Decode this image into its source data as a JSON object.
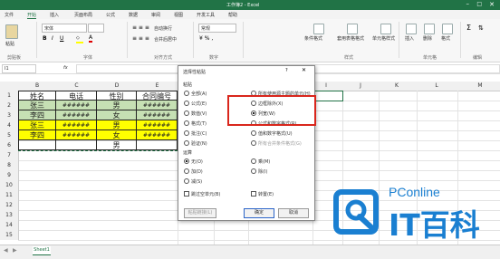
{
  "window": {
    "title": "工作簿2 - Excel"
  },
  "menu": {
    "tabs": [
      "文件",
      "开始",
      "插入",
      "页面布局",
      "公式",
      "数据",
      "审阅",
      "视图",
      "开发工具",
      "帮助"
    ],
    "active": "开始"
  },
  "ribbon": {
    "clipboard": {
      "paste": "粘贴",
      "group": "剪贴板"
    },
    "font": {
      "font_name": "宋体",
      "group": "字体"
    },
    "alignment": {
      "wrap": "自动换行",
      "merge": "合并后居中",
      "group": "对齐方式"
    },
    "number": {
      "format": "常规",
      "group": "数字"
    },
    "styles": {
      "conditional": "条件格式",
      "table": "套用表格格式",
      "cell": "单元格样式",
      "group": "样式"
    },
    "cells": {
      "insert": "插入",
      "delete": "删除",
      "format": "格式",
      "group": "单元格"
    },
    "editing": {
      "group": "编辑"
    }
  },
  "formula_bar": {
    "name_box": "I1",
    "fx": "fx"
  },
  "sheet": {
    "columns": [
      "B",
      "C",
      "D",
      "E",
      "F",
      "G",
      "H",
      "I",
      "J",
      "K",
      "L",
      "M"
    ],
    "row_numbers": [
      "1",
      "2",
      "3",
      "4",
      "5",
      "6",
      "7",
      "8",
      "9",
      "10",
      "11",
      "12",
      "13",
      "14",
      "15"
    ],
    "headers": [
      "姓名",
      "电话",
      "性别",
      "合同编号"
    ],
    "rows": [
      [
        "张三",
        "######",
        "男",
        "######"
      ],
      [
        "李四",
        "######",
        "女",
        "######"
      ],
      [
        "张三",
        "######",
        "男",
        "######"
      ],
      [
        "李四",
        "######",
        "女",
        "######"
      ],
      [
        "",
        "",
        "男",
        ""
      ]
    ],
    "colors": {
      "green_rows": "#c6e0b4",
      "yellow_rows": "#ffff00"
    },
    "tab": "Sheet1"
  },
  "dialog": {
    "title": "选择性粘贴",
    "paste_label": "粘贴",
    "paste_left": [
      "全部(A)",
      "公式(E)",
      "数值(V)",
      "格式(T)",
      "批注(C)",
      "验证(N)"
    ],
    "paste_right": [
      "所有使用源主题的单元(H)",
      "边框除外(X)",
      "列宽(W)",
      "公式和数字格式(R)",
      "值和数字格式(U)",
      "所有合并条件格式(G)"
    ],
    "operation_label": "运算",
    "op_left": [
      "无(O)",
      "加(D)",
      "减(S)"
    ],
    "op_right": [
      "乘(M)",
      "除(I)"
    ],
    "skip_blanks": "跳过空单元(B)",
    "transpose": "转置(E)",
    "paste_link": "粘贴链接(L)",
    "ok": "确定",
    "cancel": "取消",
    "selected": "列宽(W)",
    "highlight_color": "#d9261c"
  },
  "watermark": {
    "brand": "PConline",
    "cn": "IT百科",
    "color": "#1a7fd1"
  }
}
